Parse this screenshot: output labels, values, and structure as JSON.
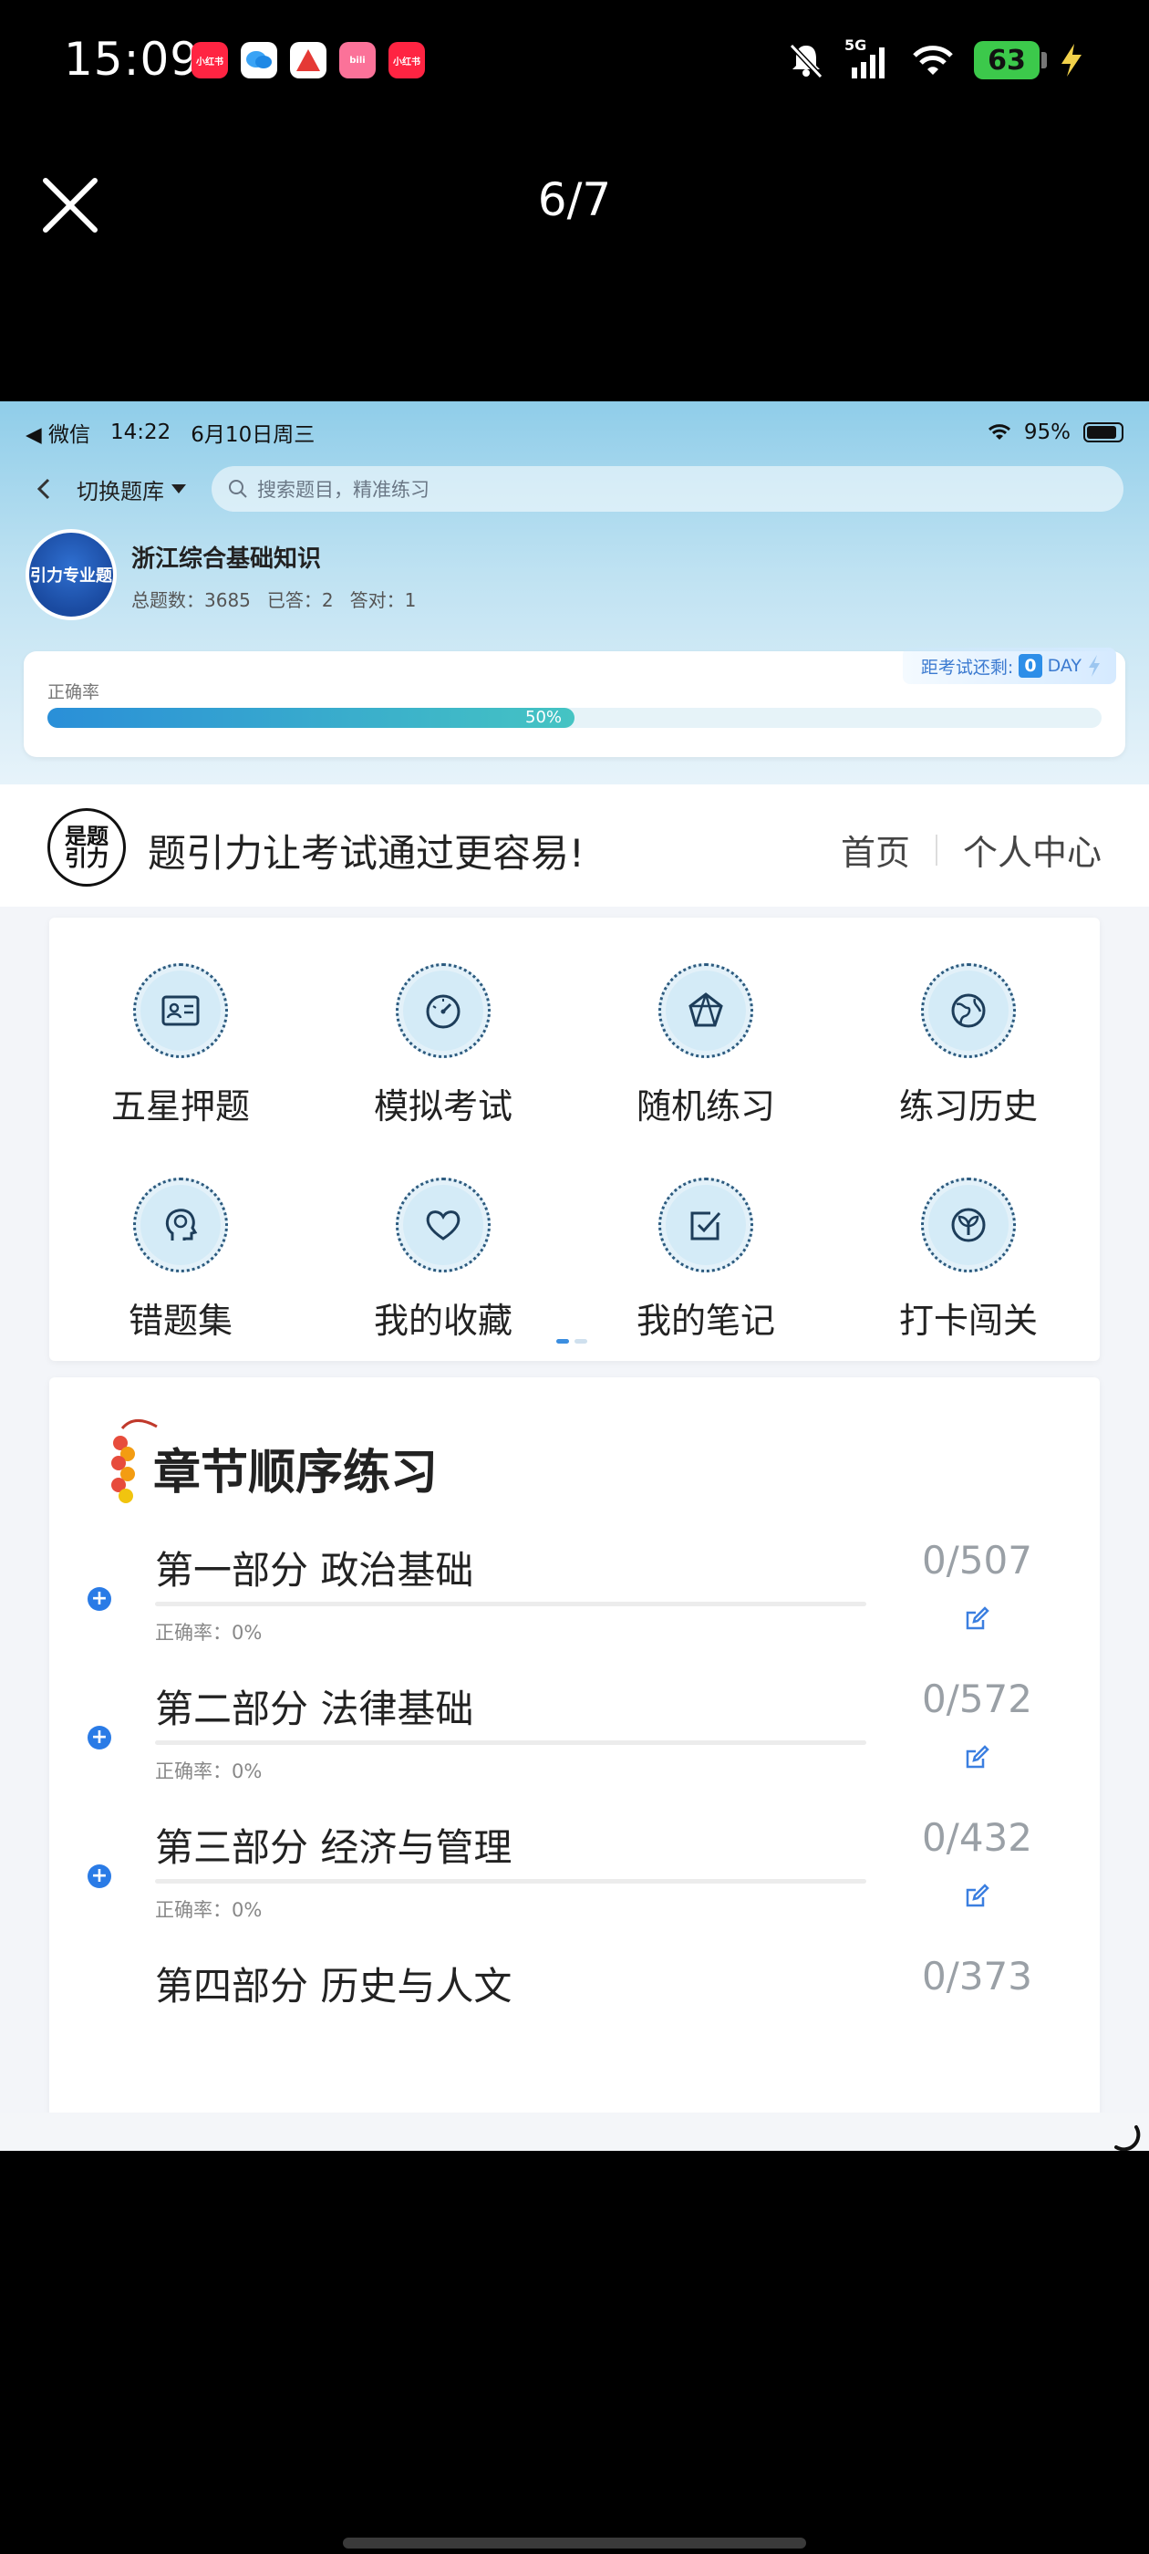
{
  "phone_status": {
    "time": "15:09",
    "apps": [
      {
        "icon": "xiaohongshu-icon",
        "label": "小红书",
        "color": "#ff2442"
      },
      {
        "icon": "messages-icon",
        "label": "",
        "color": "#3aa3f5"
      },
      {
        "icon": "adobe-icon",
        "label": "",
        "color": "#e53935"
      },
      {
        "icon": "bilibili-icon",
        "label": "bili",
        "color": "#fb7299"
      },
      {
        "icon": "xiaohongshu-icon",
        "label": "小红书",
        "color": "#ff2442"
      }
    ],
    "network": "5G",
    "battery": "63"
  },
  "viewer": {
    "counter": "6/7"
  },
  "ipad_status": {
    "back_app": "◀ 微信",
    "time": "14:22",
    "date": "6月10日周三",
    "battery": "95%"
  },
  "navbar": {
    "switch_label": "切换题库",
    "search_placeholder": "搜索题目，精准练习"
  },
  "bank": {
    "logo_text": "引力专业题",
    "name": "浙江综合基础知识",
    "total_label": "总题数：3685",
    "answered_label": "已答：2",
    "correct_label": "答对：1"
  },
  "accuracy": {
    "label": "正确率",
    "percent_text": "50%",
    "percent_value": 0.5,
    "countdown_label": "距考试还剩:",
    "countdown_days": "0",
    "countdown_unit": "DAY"
  },
  "site": {
    "logo_text": "是题\n引力",
    "slogan": "题引力让考试通过更容易!",
    "nav": [
      "首页",
      "个人中心"
    ]
  },
  "menu": [
    {
      "label": "五星押题",
      "icon": "id-card-icon"
    },
    {
      "label": "模拟考试",
      "icon": "speedometer-icon"
    },
    {
      "label": "随机练习",
      "icon": "random-shape-icon"
    },
    {
      "label": "练习历史",
      "icon": "globe-icon"
    },
    {
      "label": "错题集",
      "icon": "head-brain-icon"
    },
    {
      "label": "我的收藏",
      "icon": "heart-icon"
    },
    {
      "label": "我的笔记",
      "icon": "checkbox-note-icon"
    },
    {
      "label": "打卡闯关",
      "icon": "sprout-icon"
    }
  ],
  "chapters": {
    "title": "章节顺序练习",
    "items": [
      {
        "title": "第一部分 政治基础",
        "accuracy": "正确率：0%",
        "count": "0/507"
      },
      {
        "title": "第二部分 法律基础",
        "accuracy": "正确率：0%",
        "count": "0/572"
      },
      {
        "title": "第三部分 经济与管理",
        "accuracy": "正确率：0%",
        "count": "0/432"
      },
      {
        "title": "第四部分 历史与人文",
        "accuracy": "",
        "count": "0/373"
      }
    ]
  },
  "colors": {
    "accent_blue": "#2a7be6",
    "progress_start": "#2a8fd8",
    "progress_end": "#45c4c3"
  }
}
